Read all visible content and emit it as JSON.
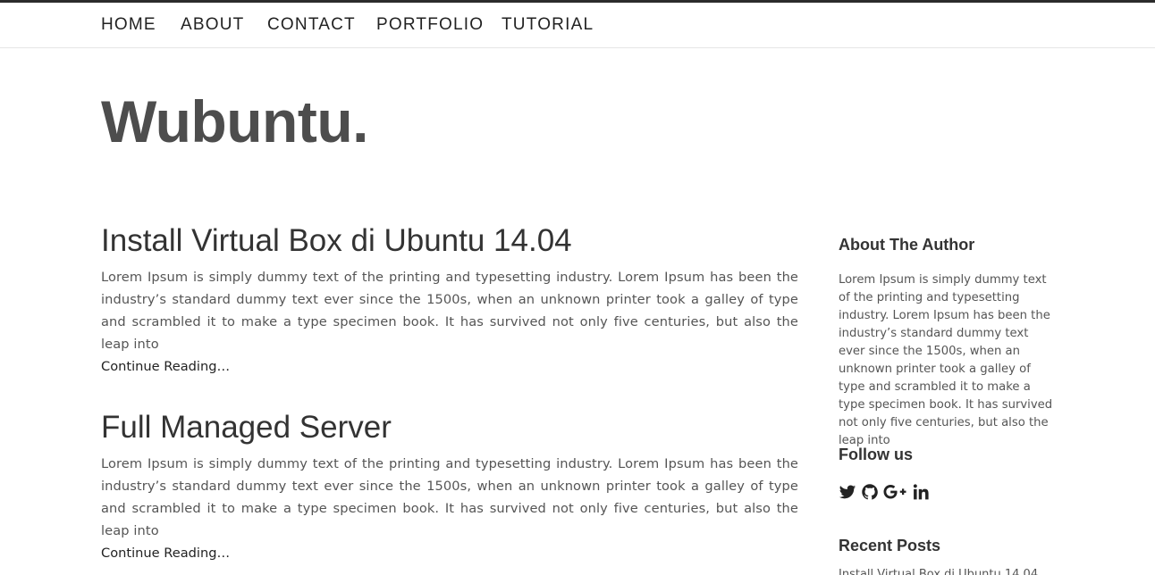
{
  "nav": {
    "items": [
      {
        "label": "HOME"
      },
      {
        "label": "ABOUT"
      },
      {
        "label": "CONTACT"
      },
      {
        "label": "PORTFOLIO"
      },
      {
        "label": "TUTORIAL"
      }
    ]
  },
  "site": {
    "title": "Wubuntu."
  },
  "posts": [
    {
      "title": "Install Virtual Box di Ubuntu 14.04",
      "excerpt": "Lorem Ipsum is simply dummy text of the printing and typesetting industry. Lorem Ipsum has been the industry’s standard dummy text ever since the 1500s, when an unknown printer took a galley of type and scrambled it to make a type specimen book. It has survived not only five centuries, but also the leap into",
      "read_more": "Continue Reading…"
    },
    {
      "title": "Full Managed Server",
      "excerpt": "Lorem Ipsum is simply dummy text of the printing and typesetting industry. Lorem Ipsum has been the industry’s standard dummy text ever since the 1500s, when an unknown printer took a galley of type and scrambled it to make a type specimen book. It has survived not only five centuries, but also the leap into",
      "read_more": "Continue Reading…"
    }
  ],
  "sidebar": {
    "about": {
      "title": "About The Author",
      "text": "Lorem Ipsum is simply dummy text of the printing and typesetting industry. Lorem Ipsum has been the industry’s standard dummy text ever since the 1500s, when an unknown printer took a galley of type and scrambled it to make a type specimen book. It has survived not only five centuries, but also the leap into"
    },
    "follow": {
      "title": "Follow us",
      "icons": [
        "twitter-icon",
        "github-icon",
        "google-plus-icon",
        "linkedin-icon"
      ]
    },
    "recent": {
      "title": "Recent Posts",
      "items": [
        "Install Virtual Box di Ubuntu 14.04"
      ]
    }
  },
  "colors": {
    "text": "#555555",
    "heading": "#333333",
    "site_title": "#4d4d4d",
    "nav_text": "#222222",
    "top_bar": "#2b2b2b"
  }
}
